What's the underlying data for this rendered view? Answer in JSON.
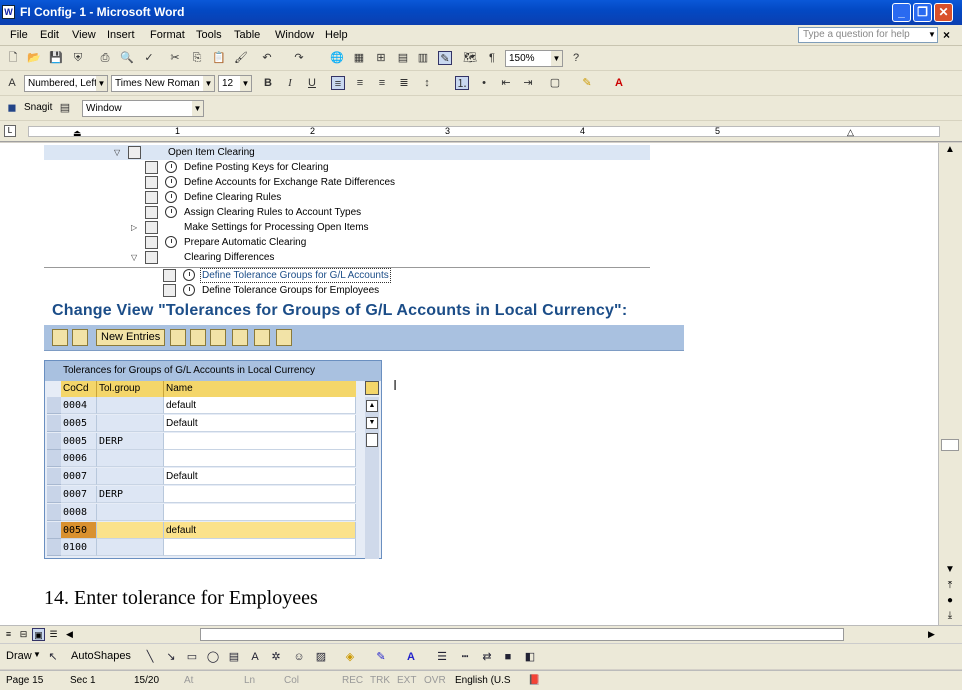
{
  "window": {
    "title": "FI Config- 1 - Microsoft Word"
  },
  "menu": [
    "File",
    "Edit",
    "View",
    "Insert",
    "Format",
    "Tools",
    "Table",
    "Window",
    "Help"
  ],
  "help_placeholder": "Type a question for help",
  "toolbar": {
    "zoom": "150%"
  },
  "formatting": {
    "style": "Numbered, Left",
    "font": "Times New Roman",
    "size": "12"
  },
  "snagit": {
    "label": "Snagit",
    "capture_mode": "Window"
  },
  "ruler": {
    "numbers": [
      "1",
      "2",
      "3",
      "4",
      "5"
    ]
  },
  "tree": {
    "items": [
      {
        "label": "Open Item Clearing"
      },
      {
        "label": "Define Posting Keys for Clearing"
      },
      {
        "label": "Define Accounts for Exchange Rate Differences"
      },
      {
        "label": "Define Clearing Rules"
      },
      {
        "label": "Assign Clearing Rules to Account Types"
      },
      {
        "label": "Make Settings for Processing Open Items"
      },
      {
        "label": "Prepare Automatic Clearing"
      },
      {
        "label": "Clearing Differences"
      },
      {
        "label": "Define Tolerance Groups for G/L Accounts"
      },
      {
        "label": "Define Tolerance Groups for Employees"
      }
    ]
  },
  "sap": {
    "heading": "Change View \"Tolerances for Groups of G/L Accounts in Local Currency\":",
    "new_entries": "New Entries",
    "table_title": "Tolerances for Groups of G/L Accounts in Local Currency",
    "columns": [
      "CoCd",
      "Tol.group",
      "Name"
    ],
    "rows": [
      {
        "cocd": "0004",
        "tol": "",
        "name": "default"
      },
      {
        "cocd": "0005",
        "tol": "",
        "name": "Default"
      },
      {
        "cocd": "0005",
        "tol": "DERP",
        "name": ""
      },
      {
        "cocd": "0006",
        "tol": "",
        "name": ""
      },
      {
        "cocd": "0007",
        "tol": "",
        "name": "Default"
      },
      {
        "cocd": "0007",
        "tol": "DERP",
        "name": ""
      },
      {
        "cocd": "0008",
        "tol": "",
        "name": ""
      },
      {
        "cocd": "0050",
        "tol": "",
        "name": "default"
      },
      {
        "cocd": "0100",
        "tol": "",
        "name": ""
      }
    ]
  },
  "step_text": "14. Enter tolerance for Employees",
  "drawbar": {
    "draw": "Draw",
    "autoshapes": "AutoShapes"
  },
  "status": {
    "page": "Page 15",
    "sec": "Sec 1",
    "pages": "15/20",
    "at": "At",
    "ln": "Ln",
    "col": "Col",
    "rec": "REC",
    "trk": "TRK",
    "ext": "EXT",
    "ovr": "OVR",
    "lang": "English (U.S"
  }
}
